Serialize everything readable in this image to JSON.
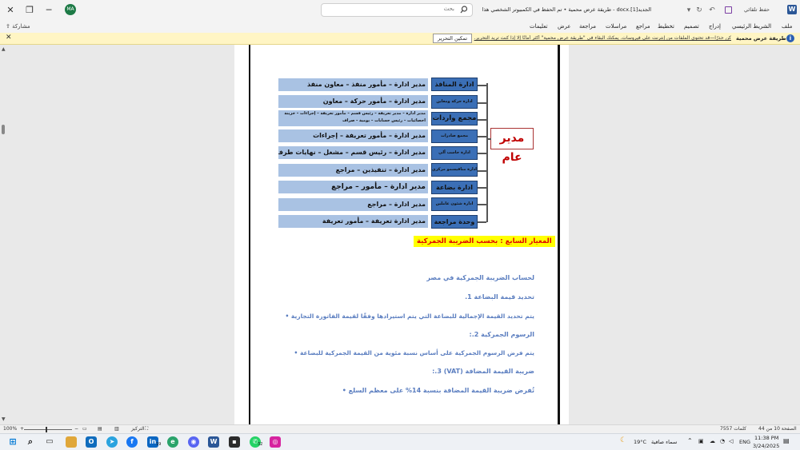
{
  "titlebar": {
    "doc_title": "الجديد[1].docx  -  طريقة عرض محمية • تم الحفظ في الكمبيوتر الشخصي هذا",
    "search_placeholder": "بحث",
    "autosave_label": "حفظ تلقائي",
    "avatar_initials": "MA",
    "window_controls": [
      "─",
      "❐",
      "✕"
    ]
  },
  "ribbon": {
    "tabs": [
      "ملف",
      "الشريط الرئيسي",
      "إدراج",
      "تصميم",
      "تخطيط",
      "مراجع",
      "مراسلات",
      "مراجعة",
      "عرض",
      "تعليمات"
    ],
    "share_label": "مشاركة"
  },
  "message_bar": {
    "title": "طريقة عرض محمية",
    "text": "كن حذرًا—قد تحتوي الملفات من إنترنت على فيروسات. يمكنك البقاء في \"طريقة عرض محمية\" أكثر أمانًا إلا إذا كنت تريد التحرير.",
    "enable_button": "تمكين التحرير"
  },
  "org_chart": {
    "head": "مدير عام",
    "departments": [
      {
        "name": "ادارة المنافذ",
        "roles": "مدير ادارة – مأمور منفذ – معاون منفذ"
      },
      {
        "name": "ادارة حركة ومعاين",
        "roles": "مدير ادارة – مأمور حركة – معاون"
      },
      {
        "name": "مجمع واردات",
        "roles": "مدير ادارة – مدير تعريفة – رئيس قسم – مأمور تعريفة – إجراءات – خزينة احصائيات – رئيس حسابات – يومية - صراف"
      },
      {
        "name": "مجمع صادرات",
        "roles": "مدير ادارة – مأمور تعريفة – إجراءات"
      },
      {
        "name": "ادارة حاسب آلي",
        "roles": "مدير ادارة – رئيس قسم – مشغل – نهايات طرفية"
      },
      {
        "name": "ادارة مناقيسمو مركزي",
        "roles": "مدير ادارة – تنفيذين – مراجع"
      },
      {
        "name": "ادارة بضاعة",
        "roles": "مدير ادارة – مأمور – مراجع"
      },
      {
        "name": "ادارة شئون عاملين",
        "roles": "مدير ادارة – مراجع"
      },
      {
        "name": "وحدة مراجعة",
        "roles": "مدير ادارة تعريفة – مأمور تعريفة"
      }
    ]
  },
  "body": {
    "heading": "المعيار السابع : بحسب الضريبة الجمركية",
    "lines": [
      "لحساب الضريبة الجمركية في مصر",
      "تحديد قيمة البضاعة 1.",
      "يتم تحديد القيمة الإجمالية للبضاعة التي يتم استيرادها وفقًا لقيمة الفاتورة التجارية  •",
      "الرسوم الجمركية 2.:",
      "يتم فرض الرسوم الجمركية على أساس نسبة مئوية من القيمة الجمركية للبضاعة  •",
      "ضريبة القيمة المضافة (VAT) 3.:",
      "تُفرض ضريبة القيمة المضافة بنسبة 14% على معظم السلع  •"
    ]
  },
  "statusbar": {
    "page": "الصفحة 10 من 44",
    "words": "7557 كلمات",
    "focus": "التركيز",
    "zoom": "100%"
  },
  "taskbar": {
    "weather_temp": "19°C",
    "weather_text": "سماء صافية",
    "lang": "ENG",
    "time": "11:38 PM",
    "date": "3/24/2025",
    "linkedin_badge": "19",
    "whatsapp_badge": "32"
  },
  "colors": {
    "dept_fill": "#3b6fb6",
    "role_fill": "#a9c2e3",
    "head_text": "#c00000",
    "body_text": "#5b7ec0",
    "highlight": "#ffff00"
  }
}
